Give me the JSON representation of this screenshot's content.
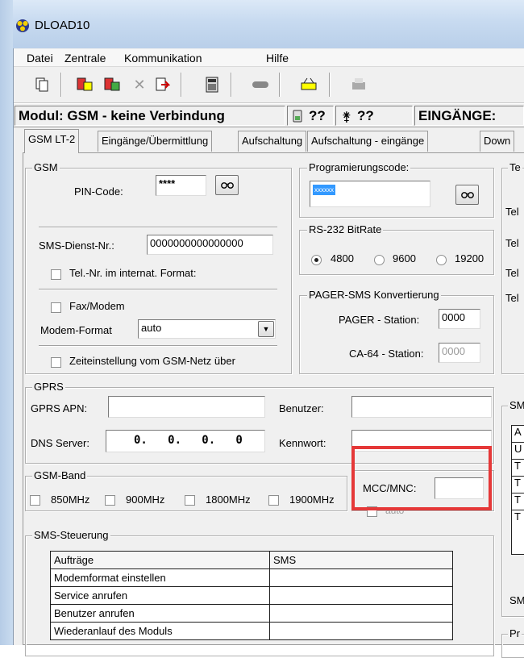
{
  "window": {
    "title": "DLOAD10"
  },
  "menu": [
    "Datei",
    "Zentrale",
    "Kommunikation",
    "Hilfe"
  ],
  "status": {
    "module": "Modul: GSM - keine Verbindung",
    "signal": "??",
    "antenna": "??",
    "inputs": "EINGÄNGE:"
  },
  "tabs": [
    "GSM LT-2",
    "Eingänge/Übermittlung",
    "Aufschaltung",
    "Aufschaltung - eingänge",
    "Down"
  ],
  "gsm": {
    "legend": "GSM",
    "pin_label": "PIN-Code:",
    "pin_value": "****",
    "sms_label": "SMS-Dienst-Nr.:",
    "sms_value": "0000000000000000",
    "intl_label": "Tel.-Nr. im internat. Format:",
    "fax_label": "Fax/Modem",
    "modem_label": "Modem-Format",
    "modem_value": "auto",
    "time_label": "Zeiteinstellung vom GSM-Netz über"
  },
  "prog": {
    "legend": "Programierungscode:",
    "value": "xxxxxx"
  },
  "rs232": {
    "legend": "RS-232 BitRate",
    "options": [
      "4800",
      "9600",
      "19200"
    ],
    "selected": "4800"
  },
  "pager": {
    "legend": "PAGER-SMS Konvertierung",
    "pager_label": "PAGER - Station:",
    "pager_value": "0000",
    "ca_label": "CA-64 - Station:",
    "ca_value": "0000"
  },
  "right": {
    "tel": [
      "Te",
      "Tel",
      "Tel",
      "Tel",
      "Tel"
    ],
    "sm": "SM",
    "sm2": "SM",
    "pr": "Pr",
    "rows": [
      "A",
      "U",
      "T",
      "T",
      "T",
      "T"
    ]
  },
  "gprs": {
    "legend": "GPRS",
    "apn_label": "GPRS APN:",
    "user_label": "Benutzer:",
    "dns_label": "DNS Server:",
    "dns_value": "0.   0.   0.   0",
    "pass_label": "Kennwort:"
  },
  "band": {
    "legend": "GSM-Band",
    "options": [
      "850MHz",
      "900MHz",
      "1800MHz",
      "1900MHz"
    ]
  },
  "mcc": {
    "label": "MCC/MNC:",
    "auto": "auto"
  },
  "smsctl": {
    "legend": "SMS-Steuerung",
    "headers": [
      "Aufträge",
      "SMS"
    ],
    "rows": [
      "Modemformat einstellen",
      "Service anrufen",
      "Benutzer anrufen",
      "Wiederanlauf des Moduls"
    ]
  },
  "colors": {
    "highlight": "#e53838",
    "selection": "#3399ff"
  }
}
